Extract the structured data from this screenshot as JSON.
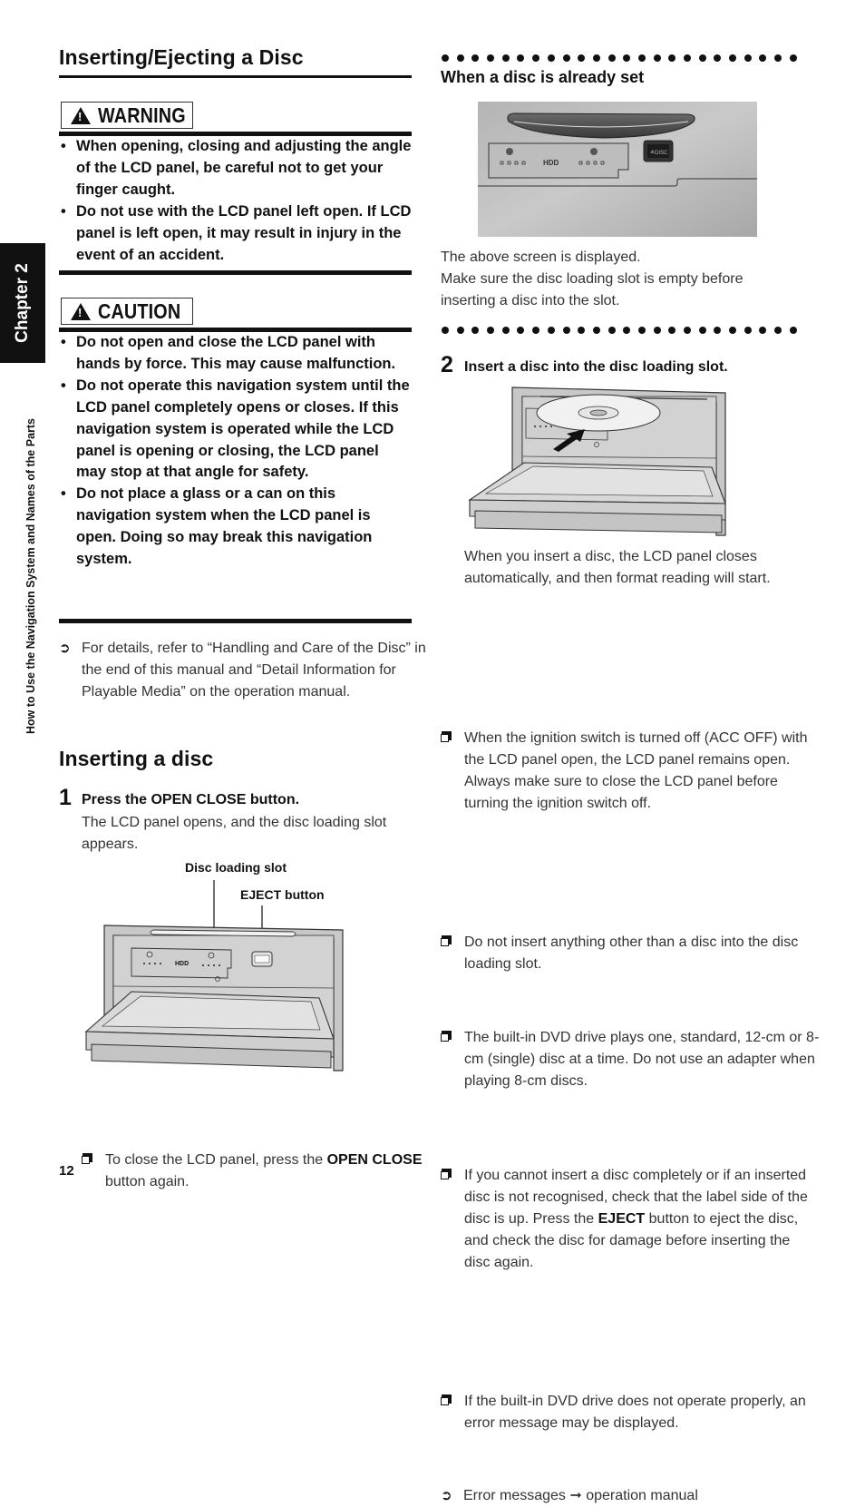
{
  "sidebar": {
    "chapter_label": "Chapter 2",
    "section_title": "How to Use the Navigation System and Names of the Parts"
  },
  "left": {
    "title": "Inserting/Ejecting a Disc",
    "warning": {
      "label": "WARNING",
      "icon": "warning-triangle-icon",
      "items": [
        "When opening, closing and adjusting the angle of the LCD panel, be careful not to get your finger caught.",
        "Do not use with the LCD panel left open. If LCD panel is left open, it may result in injury in the event of an accident."
      ]
    },
    "caution": {
      "label": "CAUTION",
      "icon": "warning-triangle-icon",
      "items": [
        "Do not open and close the LCD panel with hands by force. This may cause malfunction.",
        "Do not operate this navigation system until the LCD panel completely opens or closes. If this navigation system is operated while the LCD panel is opening or closing, the LCD panel may stop at that angle for safety.",
        "Do not place a glass or a can on this navigation system when the LCD panel is open. Doing so may break this navigation system."
      ]
    },
    "reference": "For details, refer to “Handling and Care of the Disc” in the end of this manual and “Detail Information for Playable Media” on the operation manual.",
    "section_heading": "Inserting a disc",
    "step1": {
      "number": "1",
      "title_pre": "Press the ",
      "title_bold": "OPEN CLOSE",
      "title_post": " button.",
      "desc": "The LCD panel opens, and the disc loading slot appears."
    },
    "figure1": {
      "callout_slot": "Disc loading slot",
      "callout_eject": "EJECT button",
      "panel_text": "HDD"
    },
    "note_close": {
      "pre": "To close the LCD panel, press the ",
      "bold": "OPEN CLOSE",
      "post": " button again."
    }
  },
  "right": {
    "already_set_heading": "When a disc is already set",
    "photo_text": "HDD",
    "photo_eject_label": "≙DISC",
    "already_set_text1": "The above screen is displayed.",
    "already_set_text2": "Make sure the disc loading slot is empty before inserting a disc into the slot.",
    "step2": {
      "number": "2",
      "title": "Insert a disc into the disc loading slot.",
      "desc": "When you insert a disc, the LCD panel closes automatically, and then format reading will start."
    },
    "notes": [
      {
        "text": "When the ignition switch is turned off (ACC OFF) with the LCD panel open, the LCD panel remains open. Always make sure to close the LCD panel before turning the ignition switch off."
      },
      {
        "text": "Do not insert anything other than a disc into the disc loading slot."
      },
      {
        "text": "The built-in DVD drive plays one, standard, 12-cm or 8-cm (single) disc at a time. Do not use an adapter when playing 8-cm discs."
      },
      {
        "pre": "If you cannot insert a disc completely or if an inserted disc is not recognised, check that the label side of the disc is up. Press the ",
        "bold": "EJECT",
        "post": " button to eject the disc, and check the disc for damage before inserting the disc again."
      },
      {
        "text": "If the built-in DVD drive does not operate properly, an error message may be displayed."
      }
    ],
    "error_ref": {
      "pre": "Error messages ",
      "arrow": "➞",
      "post": " operation manual"
    }
  },
  "footer": {
    "page_number": "12"
  }
}
